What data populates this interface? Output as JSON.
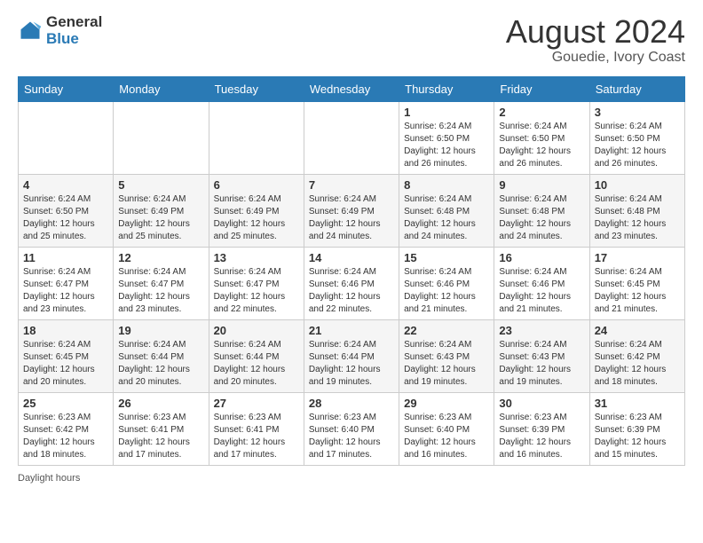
{
  "header": {
    "logo_line1": "General",
    "logo_line2": "Blue",
    "month_year": "August 2024",
    "location": "Gouedie, Ivory Coast"
  },
  "days_of_week": [
    "Sunday",
    "Monday",
    "Tuesday",
    "Wednesday",
    "Thursday",
    "Friday",
    "Saturday"
  ],
  "weeks": [
    [
      {
        "day": "",
        "info": ""
      },
      {
        "day": "",
        "info": ""
      },
      {
        "day": "",
        "info": ""
      },
      {
        "day": "",
        "info": ""
      },
      {
        "day": "1",
        "info": "Sunrise: 6:24 AM\nSunset: 6:50 PM\nDaylight: 12 hours\nand 26 minutes."
      },
      {
        "day": "2",
        "info": "Sunrise: 6:24 AM\nSunset: 6:50 PM\nDaylight: 12 hours\nand 26 minutes."
      },
      {
        "day": "3",
        "info": "Sunrise: 6:24 AM\nSunset: 6:50 PM\nDaylight: 12 hours\nand 26 minutes."
      }
    ],
    [
      {
        "day": "4",
        "info": "Sunrise: 6:24 AM\nSunset: 6:50 PM\nDaylight: 12 hours\nand 25 minutes."
      },
      {
        "day": "5",
        "info": "Sunrise: 6:24 AM\nSunset: 6:49 PM\nDaylight: 12 hours\nand 25 minutes."
      },
      {
        "day": "6",
        "info": "Sunrise: 6:24 AM\nSunset: 6:49 PM\nDaylight: 12 hours\nand 25 minutes."
      },
      {
        "day": "7",
        "info": "Sunrise: 6:24 AM\nSunset: 6:49 PM\nDaylight: 12 hours\nand 24 minutes."
      },
      {
        "day": "8",
        "info": "Sunrise: 6:24 AM\nSunset: 6:48 PM\nDaylight: 12 hours\nand 24 minutes."
      },
      {
        "day": "9",
        "info": "Sunrise: 6:24 AM\nSunset: 6:48 PM\nDaylight: 12 hours\nand 24 minutes."
      },
      {
        "day": "10",
        "info": "Sunrise: 6:24 AM\nSunset: 6:48 PM\nDaylight: 12 hours\nand 23 minutes."
      }
    ],
    [
      {
        "day": "11",
        "info": "Sunrise: 6:24 AM\nSunset: 6:47 PM\nDaylight: 12 hours\nand 23 minutes."
      },
      {
        "day": "12",
        "info": "Sunrise: 6:24 AM\nSunset: 6:47 PM\nDaylight: 12 hours\nand 23 minutes."
      },
      {
        "day": "13",
        "info": "Sunrise: 6:24 AM\nSunset: 6:47 PM\nDaylight: 12 hours\nand 22 minutes."
      },
      {
        "day": "14",
        "info": "Sunrise: 6:24 AM\nSunset: 6:46 PM\nDaylight: 12 hours\nand 22 minutes."
      },
      {
        "day": "15",
        "info": "Sunrise: 6:24 AM\nSunset: 6:46 PM\nDaylight: 12 hours\nand 21 minutes."
      },
      {
        "day": "16",
        "info": "Sunrise: 6:24 AM\nSunset: 6:46 PM\nDaylight: 12 hours\nand 21 minutes."
      },
      {
        "day": "17",
        "info": "Sunrise: 6:24 AM\nSunset: 6:45 PM\nDaylight: 12 hours\nand 21 minutes."
      }
    ],
    [
      {
        "day": "18",
        "info": "Sunrise: 6:24 AM\nSunset: 6:45 PM\nDaylight: 12 hours\nand 20 minutes."
      },
      {
        "day": "19",
        "info": "Sunrise: 6:24 AM\nSunset: 6:44 PM\nDaylight: 12 hours\nand 20 minutes."
      },
      {
        "day": "20",
        "info": "Sunrise: 6:24 AM\nSunset: 6:44 PM\nDaylight: 12 hours\nand 20 minutes."
      },
      {
        "day": "21",
        "info": "Sunrise: 6:24 AM\nSunset: 6:44 PM\nDaylight: 12 hours\nand 19 minutes."
      },
      {
        "day": "22",
        "info": "Sunrise: 6:24 AM\nSunset: 6:43 PM\nDaylight: 12 hours\nand 19 minutes."
      },
      {
        "day": "23",
        "info": "Sunrise: 6:24 AM\nSunset: 6:43 PM\nDaylight: 12 hours\nand 19 minutes."
      },
      {
        "day": "24",
        "info": "Sunrise: 6:24 AM\nSunset: 6:42 PM\nDaylight: 12 hours\nand 18 minutes."
      }
    ],
    [
      {
        "day": "25",
        "info": "Sunrise: 6:23 AM\nSunset: 6:42 PM\nDaylight: 12 hours\nand 18 minutes."
      },
      {
        "day": "26",
        "info": "Sunrise: 6:23 AM\nSunset: 6:41 PM\nDaylight: 12 hours\nand 17 minutes."
      },
      {
        "day": "27",
        "info": "Sunrise: 6:23 AM\nSunset: 6:41 PM\nDaylight: 12 hours\nand 17 minutes."
      },
      {
        "day": "28",
        "info": "Sunrise: 6:23 AM\nSunset: 6:40 PM\nDaylight: 12 hours\nand 17 minutes."
      },
      {
        "day": "29",
        "info": "Sunrise: 6:23 AM\nSunset: 6:40 PM\nDaylight: 12 hours\nand 16 minutes."
      },
      {
        "day": "30",
        "info": "Sunrise: 6:23 AM\nSunset: 6:39 PM\nDaylight: 12 hours\nand 16 minutes."
      },
      {
        "day": "31",
        "info": "Sunrise: 6:23 AM\nSunset: 6:39 PM\nDaylight: 12 hours\nand 15 minutes."
      }
    ]
  ],
  "footer": {
    "daylight_label": "Daylight hours"
  }
}
